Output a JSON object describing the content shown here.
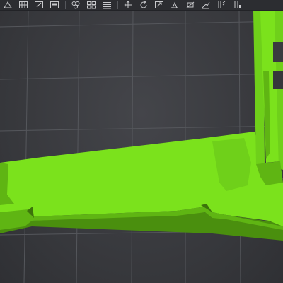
{
  "toolbar": {
    "tools": [
      {
        "icon": "perspective-icon",
        "name": "perspective-view-button"
      },
      {
        "icon": "grid-icon",
        "name": "grid-toggle-button"
      },
      {
        "icon": "edit-icon",
        "name": "edit-button"
      },
      {
        "icon": "image-icon",
        "name": "image-button"
      },
      {
        "icon": "link-icon",
        "name": "link-button"
      },
      {
        "icon": "arrange-icon",
        "name": "arrange-button"
      },
      {
        "icon": "list-icon",
        "name": "list-button"
      },
      {
        "icon": "move-icon",
        "name": "move-button"
      },
      {
        "icon": "rotate-icon",
        "name": "rotate-button"
      },
      {
        "icon": "scale-icon",
        "name": "scale-button"
      },
      {
        "icon": "place-on-face-icon",
        "name": "place-on-face-button"
      },
      {
        "icon": "cut-icon",
        "name": "cut-button"
      },
      {
        "icon": "support-paint-icon",
        "name": "support-paint-button"
      },
      {
        "icon": "seam-paint-icon",
        "name": "seam-paint-button"
      },
      {
        "icon": "color-paint-icon",
        "name": "color-paint-button"
      }
    ]
  },
  "viewport": {
    "model_color": "#7be21c",
    "model_shadow": "#5fb513",
    "model_dark": "#4a8f0e",
    "background": "#3a3b3f",
    "grid_color": "#55575c"
  }
}
